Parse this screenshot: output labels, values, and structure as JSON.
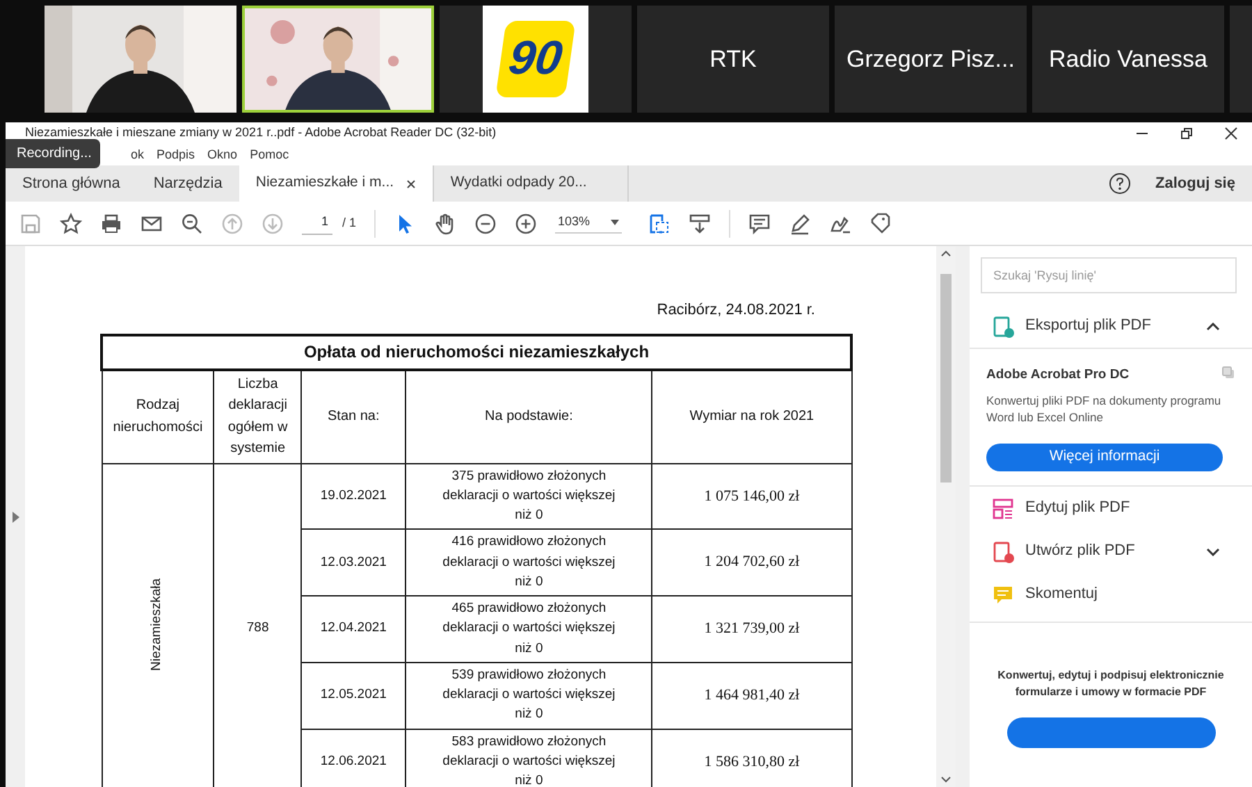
{
  "video_tiles": [
    {
      "kind": "picture",
      "speaking": false
    },
    {
      "kind": "picture",
      "speaking": true
    },
    {
      "kind": "logo",
      "label": "90",
      "speaking": false
    },
    {
      "kind": "name",
      "label": "RTK",
      "speaking": false
    },
    {
      "kind": "name",
      "label": "Grzegorz Pisz...",
      "speaking": false
    },
    {
      "kind": "name",
      "label": "Radio Vanessa",
      "speaking": false
    }
  ],
  "window": {
    "title": "Niezamieszkałe i mieszane zmiany w 2021 r..pdf - Adobe Acrobat Reader DC (32-bit)"
  },
  "recording_badge": "Recording...",
  "menu": [
    "ok",
    "Podpis",
    "Okno",
    "Pomoc"
  ],
  "tabs": [
    {
      "label": "Strona główna",
      "selected": false,
      "kind": "nav"
    },
    {
      "label": "Narzędzia",
      "selected": false,
      "kind": "nav"
    },
    {
      "label": "Niezamieszkałe i m...",
      "selected": true,
      "kind": "document"
    },
    {
      "label": "Wydatki odpady 20...",
      "selected": false,
      "kind": "document"
    }
  ],
  "sign_in": "Zaloguj się",
  "toolbar": {
    "page": "1",
    "page_total": "/ 1",
    "zoom": "103%"
  },
  "document": {
    "place_date": "Racibórz, 24.08.2021 r.",
    "table": {
      "title": "Opłata od nieruchomości niezamieszkałych",
      "columns": [
        "Rodzaj nieruchomości",
        "Liczba deklaracji ogółem w systemie",
        "Stan na:",
        "Na podstawie:",
        "Wymiar na rok 2021"
      ],
      "group_label": "Niezamieszkała",
      "declarations_total": "788",
      "rows": [
        {
          "date": "19.02.2021",
          "basis": "375 prawidłowo złożonych deklaracji o wartości większej niż 0",
          "amount": "1 075 146,00 zł"
        },
        {
          "date": "12.03.2021",
          "basis": "416 prawidłowo złożonych deklaracji o wartości większej niż 0",
          "amount": "1 204 702,60 zł"
        },
        {
          "date": "12.04.2021",
          "basis": "465 prawidłowo złożonych deklaracji o wartości większej niż 0",
          "amount": "1 321 739,00 zł"
        },
        {
          "date": "12.05.2021",
          "basis": "539 prawidłowo złożonych deklaracji o wartości większej niż 0",
          "amount": "1 464 981,40 zł"
        },
        {
          "date": "12.06.2021",
          "basis": "583 prawidłowo złożonych deklaracji o wartości większej niż 0",
          "amount": "1 586 310,80 zł"
        }
      ]
    }
  },
  "side_panel": {
    "search_placeholder": "Szukaj 'Rysuj linię'",
    "tools": [
      {
        "kind": "export",
        "label": "Eksportuj plik PDF",
        "expanded": true
      },
      {
        "kind": "edit",
        "label": "Edytuj plik PDF"
      },
      {
        "kind": "create",
        "label": "Utwórz plik PDF",
        "expanded": false
      },
      {
        "kind": "comment",
        "label": "Skomentuj"
      }
    ],
    "promo": {
      "title": "Adobe Acrobat Pro DC",
      "text": "Konwertuj pliki PDF na dokumenty programu Word lub Excel Online",
      "button": "Więcej informacji"
    },
    "footer_text": "Konwertuj, edytuj i podpisuj elektronicznie formularze i umowy w formacie PDF"
  }
}
